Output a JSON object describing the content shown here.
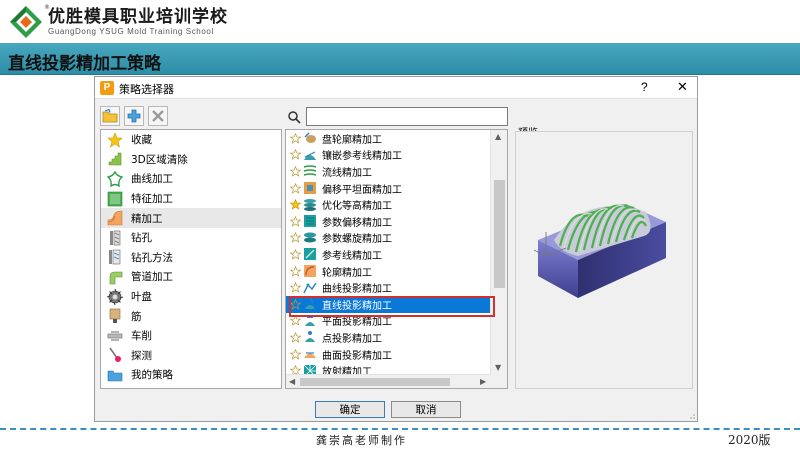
{
  "header": {
    "logo_cn": "优胜模具职业培训学校",
    "logo_en": "GuangDong YSUG Mold Training School",
    "logo_reg": "®"
  },
  "title_bar": {
    "title": "直线投影精加工策略"
  },
  "dialog": {
    "title": "策略选择器",
    "app_icon_letter": "P",
    "help": "?",
    "close": "✕",
    "search": {
      "value": "",
      "placeholder": ""
    },
    "categories": [
      {
        "label": "收藏",
        "icon": "star-icon"
      },
      {
        "label": "3D区域清除",
        "icon": "area-clearance-icon"
      },
      {
        "label": "曲线加工",
        "icon": "curve-machining-icon"
      },
      {
        "label": "特征加工",
        "icon": "feature-machining-icon"
      },
      {
        "label": "精加工",
        "icon": "finishing-icon",
        "selected": true
      },
      {
        "label": "钻孔",
        "icon": "drilling-icon"
      },
      {
        "label": "钻孔方法",
        "icon": "drilling-method-icon"
      },
      {
        "label": "管道加工",
        "icon": "pipe-machining-icon"
      },
      {
        "label": "叶盘",
        "icon": "blisk-icon"
      },
      {
        "label": "筋",
        "icon": "rib-icon"
      },
      {
        "label": "车削",
        "icon": "turning-icon"
      },
      {
        "label": "探测",
        "icon": "probing-icon"
      },
      {
        "label": "我的策略",
        "icon": "folder-icon"
      }
    ],
    "strategies": [
      {
        "label": "盘轮廓精加工",
        "starred": false
      },
      {
        "label": "镶嵌参考线精加工",
        "starred": false
      },
      {
        "label": "流线精加工",
        "starred": false
      },
      {
        "label": "偏移平坦面精加工",
        "starred": false
      },
      {
        "label": "优化等高精加工",
        "starred": true
      },
      {
        "label": "参数偏移精加工",
        "starred": false
      },
      {
        "label": "参数螺旋精加工",
        "starred": false
      },
      {
        "label": "参考线精加工",
        "starred": false
      },
      {
        "label": "轮廓精加工",
        "starred": false
      },
      {
        "label": "曲线投影精加工",
        "starred": false
      },
      {
        "label": "直线投影精加工",
        "starred": false,
        "selected": true
      },
      {
        "label": "平面投影精加工",
        "starred": false
      },
      {
        "label": "点投影精加工",
        "starred": false
      },
      {
        "label": "曲面投影精加工",
        "starred": false
      },
      {
        "label": "放射精加工",
        "starred": false
      }
    ],
    "preview_label": "预览",
    "ok_label": "确定",
    "cancel_label": "取消"
  },
  "footer": {
    "author": "龚崇高老师制作",
    "year": "2020版"
  },
  "colors": {
    "title_bar": "#2d8ea8",
    "selection": "#0a78d7",
    "highlight": "#d32f2f",
    "footer_line": "#3a8fc0"
  }
}
